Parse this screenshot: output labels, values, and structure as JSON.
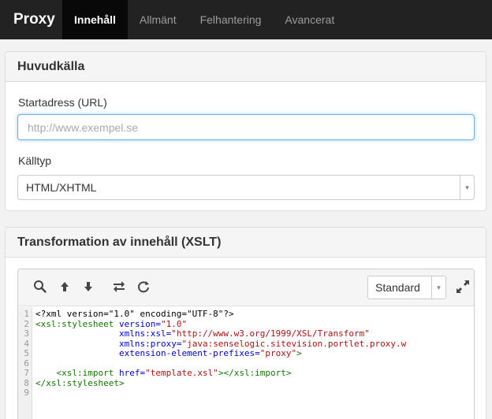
{
  "navbar": {
    "brand": "Proxy",
    "tabs": [
      {
        "label": "Innehåll",
        "active": true
      },
      {
        "label": "Allmänt",
        "active": false
      },
      {
        "label": "Felhantering",
        "active": false
      },
      {
        "label": "Avancerat",
        "active": false
      }
    ]
  },
  "main_source": {
    "title": "Huvudkälla",
    "url_label": "Startadress (URL)",
    "url_value": "",
    "url_placeholder": "http://www.exempel.se",
    "source_type_label": "Källtyp",
    "source_type_value": "HTML/XHTML"
  },
  "transformation": {
    "title": "Transformation av innehåll (XSLT)",
    "toolbar": {
      "icons": [
        "search-icon",
        "arrow-up-icon",
        "arrow-down-icon",
        "swap-icon",
        "refresh-icon"
      ],
      "mode_value": "Standard",
      "expand_icon": "expand-icon"
    },
    "line_numbers": [
      "1",
      "2",
      "3",
      "4",
      "5",
      "6",
      "7",
      "8",
      "9"
    ],
    "code": {
      "l1": "<?xml version=\"1.0\" encoding=\"UTF-8\"?>",
      "l2_tag": "<xsl:stylesheet",
      "l2_attr": "version=",
      "l2_val": "\"1.0\"",
      "l3_indent": "                ",
      "l3_attr": "xmlns:xsl=",
      "l3_val": "\"http://www.w3.org/1999/XSL/Transform\"",
      "l4_attr": "xmlns:proxy=",
      "l4_val": "\"java:senselogic.sitevision.portlet.proxy.w",
      "l5_attr": "extension-element-prefixes=",
      "l5_val": "\"proxy\"",
      "l5_close": ">",
      "l7_indent": "    ",
      "l7_tag": "<xsl:import",
      "l7_attr": "href=",
      "l7_val": "\"template.xsl\"",
      "l7_close": "></xsl:import>",
      "l8": "</xsl:stylesheet>"
    }
  },
  "colors": {
    "navbar_bg": "#222222",
    "active_tab_bg": "#080808",
    "focus_border": "#66afe9",
    "xml_tag": "#117700",
    "xml_attr": "#0000cc",
    "xml_string": "#aa1111"
  }
}
